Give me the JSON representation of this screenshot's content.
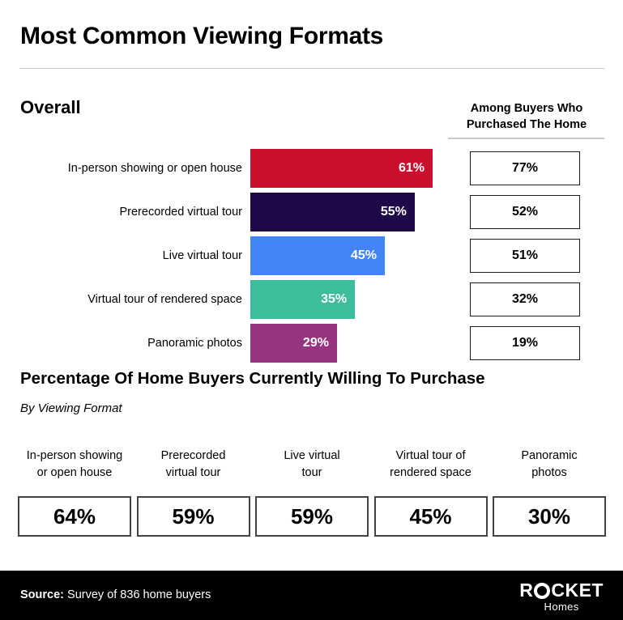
{
  "title": "Most Common Viewing Formats",
  "section1": {
    "heading": "Overall",
    "column_header_line1": "Among Buyers Who",
    "column_header_line2": "Purchased The Home"
  },
  "section2": {
    "title": "Percentage Of Home Buyers Currently Willing To Purchase",
    "subtitle": "By Viewing Format"
  },
  "footer": {
    "source_label": "Source:",
    "source_text": "Survey of 836 home buyers",
    "logo_r": "R",
    "logo_rest": "CKET",
    "logo_sub": "Homes"
  },
  "chart_data": {
    "type": "bar",
    "title": "Most Common Viewing Formats",
    "orientation": "horizontal",
    "xlabel": "",
    "ylabel": "",
    "xlim": [
      0,
      70
    ],
    "grid": false,
    "legend": false,
    "categories": [
      "In-person showing or open house",
      "Prerecorded virtual tour",
      "Live virtual tour",
      "Virtual tour of rendered space",
      "Panoramic photos"
    ],
    "series": [
      {
        "name": "Overall",
        "values": [
          61,
          55,
          45,
          35,
          29
        ],
        "labels": [
          "61%",
          "55%",
          "45%",
          "35%",
          "29%"
        ],
        "colors": [
          "#CC0E2E",
          "#1E0848",
          "#4285F4",
          "#3DBD9C",
          "#953580"
        ]
      },
      {
        "name": "Among Buyers Who Purchased The Home",
        "values": [
          77,
          52,
          51,
          32,
          19
        ],
        "labels": [
          "77%",
          "52%",
          "51%",
          "32%",
          "19%"
        ]
      }
    ],
    "secondary_table": {
      "title": "Percentage Of Home Buyers Currently Willing To Purchase",
      "subtitle": "By Viewing Format",
      "categories": [
        [
          "In-person showing",
          "or open house"
        ],
        [
          "Prerecorded",
          "virtual tour"
        ],
        [
          "Live virtual",
          "tour"
        ],
        [
          "Virtual tour of",
          "rendered space"
        ],
        [
          "Panoramic",
          "photos"
        ]
      ],
      "values": [
        64,
        59,
        59,
        45,
        30
      ],
      "labels": [
        "64%",
        "59%",
        "59%",
        "45%",
        "30%"
      ]
    },
    "source": "Survey of 836 home buyers"
  }
}
